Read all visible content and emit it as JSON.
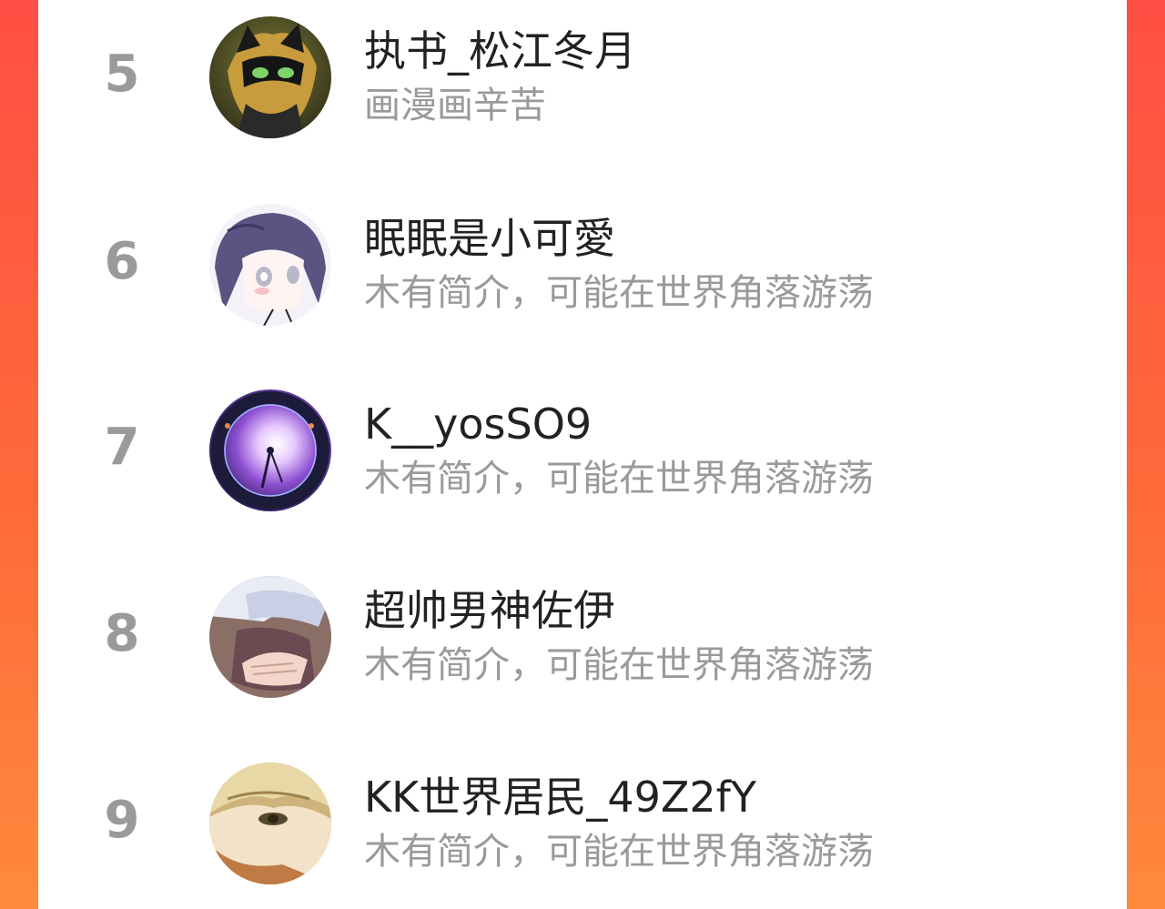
{
  "ranking": {
    "rows": [
      {
        "rank": "5",
        "name": "执书_松江冬月",
        "bio": "画漫画辛苦",
        "avatar_icon": "masked-cat-hero-avatar-icon"
      },
      {
        "rank": "6",
        "name": "眠眠是小可愛",
        "bio": "木有简介，可能在世界角落游荡",
        "avatar_icon": "anime-girl-purple-hair-avatar-icon"
      },
      {
        "rank": "7",
        "name": "K__yosSO9",
        "bio": "木有简介，可能在世界角落游荡",
        "avatar_icon": "zodiac-clock-avatar-icon"
      },
      {
        "rank": "8",
        "name": "超帅男神佐伊",
        "bio": "木有简介，可能在世界角落游荡",
        "avatar_icon": "anime-hands-avatar-icon"
      },
      {
        "rank": "9",
        "name": "KK世界居民_49Z2fY",
        "bio": "木有简介，可能在世界角落游荡",
        "avatar_icon": "anime-boy-blond-avatar-icon"
      }
    ]
  },
  "colors": {
    "background_gradient_top": "#ff4f45",
    "background_gradient_bottom": "#ff8a3c",
    "panel": "#ffffff",
    "rank_text": "#9a9a9a",
    "name_text": "#222222",
    "bio_text": "#9a9a9a"
  }
}
